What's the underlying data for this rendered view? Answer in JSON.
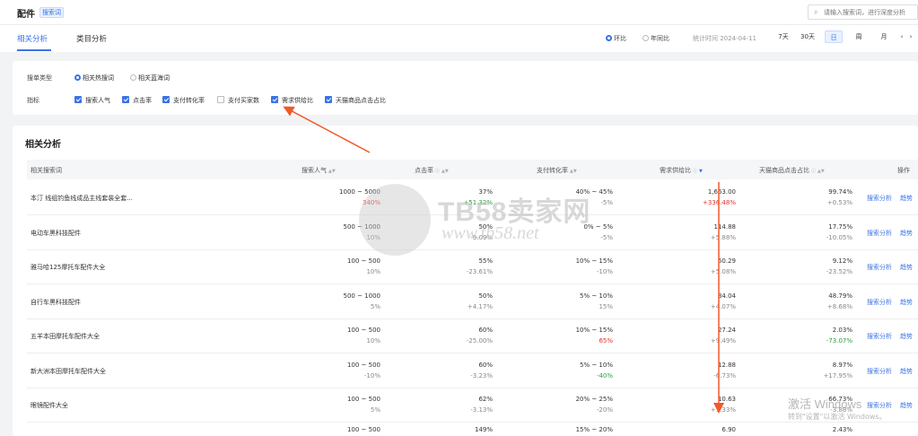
{
  "header": {
    "title": "配件",
    "tag": "搜索词",
    "search_placeholder": "请输入搜索词，进行深度分析"
  },
  "tabs": [
    {
      "label": "相关分析",
      "active": true
    },
    {
      "label": "类目分析",
      "active": false
    }
  ],
  "compare": {
    "options": [
      {
        "label": "环比",
        "selected": true
      },
      {
        "label": "年同比",
        "selected": false
      }
    ],
    "date_label": "统计时间 2024-04-11",
    "periods": [
      "7天",
      "30天",
      "日",
      "周",
      "月"
    ],
    "active_period": "日"
  },
  "filter": {
    "list_type_label": "搜单类型",
    "list_types": [
      {
        "label": "相关热搜词",
        "selected": true
      },
      {
        "label": "相关蓝海词",
        "selected": false
      }
    ],
    "metrics_label": "指标",
    "metrics": [
      {
        "label": "搜索人气",
        "checked": true
      },
      {
        "label": "点击率",
        "checked": true
      },
      {
        "label": "支付转化率",
        "checked": true
      },
      {
        "label": "支付买家数",
        "checked": false
      },
      {
        "label": "需求供给比",
        "checked": true
      },
      {
        "label": "天猫商品点击占比",
        "checked": true
      }
    ]
  },
  "table": {
    "title": "相关分析",
    "columns": [
      "相关搜索词",
      "搜索人气",
      "点击率",
      "支付转化率",
      "需求供给比",
      "天猫商品点击占比",
      "操作"
    ],
    "actions": [
      "搜索分析",
      "趋势"
    ],
    "rows": [
      {
        "keyword": "本汀 线组钓鱼线成品主线套装全套...",
        "pop": "1000 ~ 5000",
        "pop_chg": "340%",
        "pop_c": "red",
        "ctr": "37%",
        "ctr_chg": "+51.32%",
        "ctr_c": "green",
        "conv": "40% ~ 45%",
        "conv_chg": "-5%",
        "conv_c": "",
        "dsr": "1,663.00",
        "dsr_chg": "+336.48%",
        "dsr_c": "red",
        "tm": "99.74%",
        "tm_chg": "+0.53%",
        "tm_c": ""
      },
      {
        "keyword": "电动车黑科技配件",
        "pop": "500 ~ 1000",
        "pop_chg": "10%",
        "pop_c": "",
        "ctr": "50%",
        "ctr_chg": "-9.09%",
        "ctr_c": "",
        "conv": "0% ~ 5%",
        "conv_chg": "-5%",
        "conv_c": "",
        "dsr": "114.88",
        "dsr_chg": "+5.88%",
        "dsr_c": "",
        "tm": "17.75%",
        "tm_chg": "-10.05%",
        "tm_c": ""
      },
      {
        "keyword": "雅马哈125摩托车配件大全",
        "pop": "100 ~ 500",
        "pop_chg": "10%",
        "pop_c": "",
        "ctr": "55%",
        "ctr_chg": "-23.61%",
        "ctr_c": "",
        "conv": "10% ~ 15%",
        "conv_chg": "-10%",
        "conv_c": "",
        "dsr": "50.29",
        "dsr_chg": "+5.08%",
        "dsr_c": "",
        "tm": "9.12%",
        "tm_chg": "-23.52%",
        "tm_c": ""
      },
      {
        "keyword": "自行车黑科技配件",
        "pop": "500 ~ 1000",
        "pop_chg": "5%",
        "pop_c": "",
        "ctr": "50%",
        "ctr_chg": "+4.17%",
        "ctr_c": "",
        "conv": "5% ~ 10%",
        "conv_chg": "15%",
        "conv_c": "",
        "dsr": "34.04",
        "dsr_chg": "+4.07%",
        "dsr_c": "",
        "tm": "48.79%",
        "tm_chg": "+8.68%",
        "tm_c": ""
      },
      {
        "keyword": "五羊本田摩托车配件大全",
        "pop": "100 ~ 500",
        "pop_chg": "10%",
        "pop_c": "",
        "ctr": "60%",
        "ctr_chg": "-25.00%",
        "ctr_c": "",
        "conv": "10% ~ 15%",
        "conv_chg": "65%",
        "conv_c": "red",
        "dsr": "27.24",
        "dsr_chg": "+9.49%",
        "dsr_c": "",
        "tm": "2.03%",
        "tm_chg": "-73.07%",
        "tm_c": "green"
      },
      {
        "keyword": "新大洲本田摩托车配件大全",
        "pop": "100 ~ 500",
        "pop_chg": "-10%",
        "pop_c": "",
        "ctr": "60%",
        "ctr_chg": "-3.23%",
        "ctr_c": "",
        "conv": "5% ~ 10%",
        "conv_chg": "-40%",
        "conv_c": "green",
        "dsr": "12.88",
        "dsr_chg": "-6.73%",
        "dsr_c": "",
        "tm": "8.97%",
        "tm_chg": "+17.95%",
        "tm_c": ""
      },
      {
        "keyword": "眼镜配件大全",
        "pop": "100 ~ 500",
        "pop_chg": "5%",
        "pop_c": "",
        "ctr": "62%",
        "ctr_chg": "-3.13%",
        "ctr_c": "",
        "conv": "20% ~ 25%",
        "conv_chg": "-20%",
        "conv_c": "",
        "dsr": "10.63",
        "dsr_chg": "+1.33%",
        "dsr_c": "",
        "tm": "66.73%",
        "tm_chg": "-3.88%",
        "tm_c": ""
      },
      {
        "keyword": "",
        "pop": "100 ~ 500",
        "pop_chg": "",
        "pop_c": "",
        "ctr": "149%",
        "ctr_chg": "",
        "ctr_c": "",
        "conv": "15% ~ 20%",
        "conv_chg": "",
        "conv_c": "",
        "dsr": "6.90",
        "dsr_chg": "",
        "dsr_c": "",
        "tm": "2.43%",
        "tm_chg": "",
        "tm_c": ""
      }
    ]
  },
  "watermark": {
    "brand": "TB58卖家网",
    "url": "www.tb58.net"
  },
  "activation": {
    "line1": "激活 Windows",
    "line2": "转到\"设置\"以激活 Windows。"
  },
  "colors": {
    "accent": "#3b73e6",
    "up": "#e0302a",
    "down": "#2a9d3a",
    "annotation": "#f05a28"
  }
}
